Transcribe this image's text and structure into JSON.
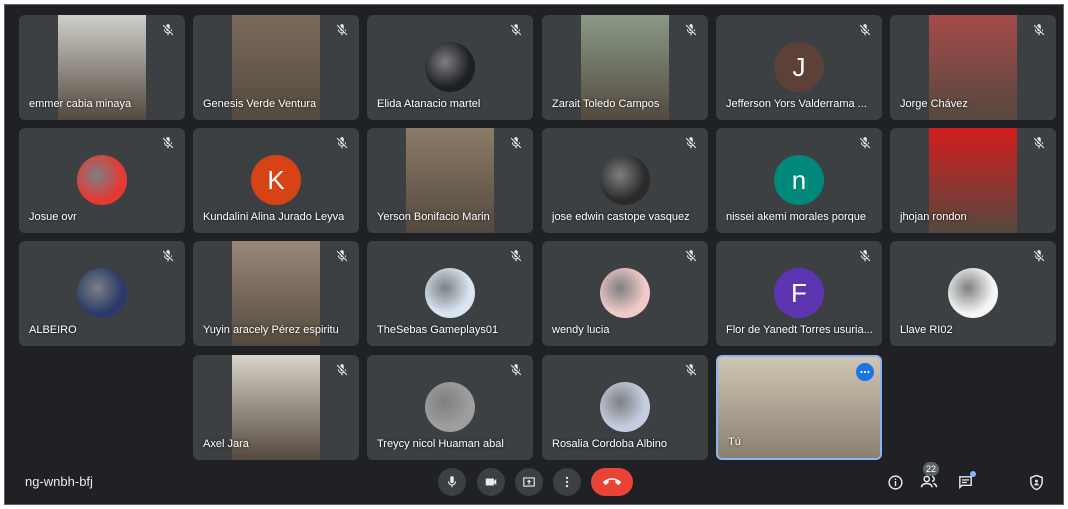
{
  "meeting": {
    "code": "ng-wnbh-bfj",
    "participant_count": "22"
  },
  "participants": [
    {
      "name": "emmer cabia minaya",
      "kind": "video",
      "bg": "#cfcfca"
    },
    {
      "name": "Genesis Verde Ventura",
      "kind": "video",
      "bg": "#7a6a5a"
    },
    {
      "name": "Elida Atanacio martel",
      "kind": "avatar",
      "bg": "#1e1e26"
    },
    {
      "name": "Zarait Toledo Campos",
      "kind": "video",
      "bg": "#8a9a86"
    },
    {
      "name": "Jefferson Yors Valderrama ...",
      "kind": "letter",
      "letter": "J",
      "bg": "#5d4037"
    },
    {
      "name": "Jorge Chávez",
      "kind": "video",
      "bg": "#a74a4a"
    },
    {
      "name": "Josue ovr",
      "kind": "avatar",
      "bg": "#e53935"
    },
    {
      "name": "Kundalini Alina Jurado Leyva",
      "kind": "letter",
      "letter": "K",
      "bg": "#d84315"
    },
    {
      "name": "Yerson Bonifacio Marin",
      "kind": "video",
      "bg": "#8a7c68"
    },
    {
      "name": "jose edwin castope vasquez",
      "kind": "avatar",
      "bg": "#2a2a2a"
    },
    {
      "name": "nissei akemi morales porque",
      "kind": "letter",
      "letter": "n",
      "bg": "#00897b"
    },
    {
      "name": "jhojan rondon",
      "kind": "video",
      "bg": "#d21e1e"
    },
    {
      "name": "ALBEIRO",
      "kind": "avatar",
      "bg": "#2b3a6a"
    },
    {
      "name": "Yuyin aracely Pérez espiritu",
      "kind": "video",
      "bg": "#9a8878"
    },
    {
      "name": "TheSebas Gameplays01",
      "kind": "avatar",
      "bg": "#d9e6f2"
    },
    {
      "name": "wendy lucia",
      "kind": "avatar",
      "bg": "#f1c9c9"
    },
    {
      "name": "Flor de Yanedt Torres usuria...",
      "kind": "letter",
      "letter": "F",
      "bg": "#5e35b1"
    },
    {
      "name": "Llave RI02",
      "kind": "avatar",
      "bg": "#f5f5f5"
    },
    {
      "name": "Axel Jara",
      "kind": "video",
      "bg": "#d8d2c8"
    },
    {
      "name": "Treycy nicol Huaman abal",
      "kind": "avatar",
      "bg": "#9e9e9e"
    },
    {
      "name": "Rosalia Cordoba Albino",
      "kind": "avatar",
      "bg": "#c5cde0"
    },
    {
      "name": "Tú",
      "kind": "self",
      "bg": "#cfc6b4"
    }
  ],
  "icons": {
    "mute": "mic-off-icon",
    "more": "more-options-icon",
    "controls": [
      "mic-icon",
      "camera-icon",
      "present-screen-icon",
      "more-vert-icon",
      "end-call-icon"
    ],
    "right": [
      "info-icon",
      "people-icon",
      "chat-icon",
      "safety-icon"
    ]
  },
  "colors": {
    "end_call": "#ea4335",
    "self_border": "#8ab4f8",
    "tile": "#3c4043"
  }
}
